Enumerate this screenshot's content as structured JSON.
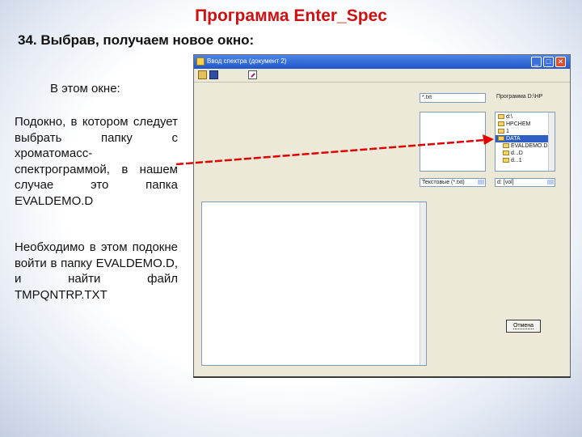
{
  "slide": {
    "title": "Программа Enter_Spec",
    "subtitle": "34. Выбрав, получаем новое окно:",
    "lead": "В этом окне:",
    "paragraph1": "Подокно, в котором следует выбрать папку с хроматомасс-спектрограммой, в нашем случае это папка EVALDEMO.D",
    "paragraph2": "Необходимо в этом подокне войти в папку EVALDEMO.D, и найти файл TMPQNTRP.TXT"
  },
  "window": {
    "title": "Ввод спектра (документ 2)",
    "controls": {
      "minimize": "_",
      "maximize": "□",
      "close": "✕"
    },
    "toolbar_icons": [
      "open-icon",
      "save-icon",
      "edit-icon"
    ],
    "file_name_field": "*.txt",
    "drive_label": "Программа D:\\HP",
    "folders": [
      "d:\\",
      "HPCHEM",
      "1",
      "DATA",
      "EVALDEMO.D",
      "d...D",
      "d...1"
    ],
    "selected_folder": "DATA",
    "file_type_select": "Текстовые (*.txt)",
    "drive_select": "d: [vol]",
    "ok_button": "Отмена"
  },
  "colors": {
    "title_red": "#d01010",
    "titlebar_blue": "#2458d0",
    "arrow_red": "#e00000",
    "selection_blue": "#2f5fc5"
  }
}
